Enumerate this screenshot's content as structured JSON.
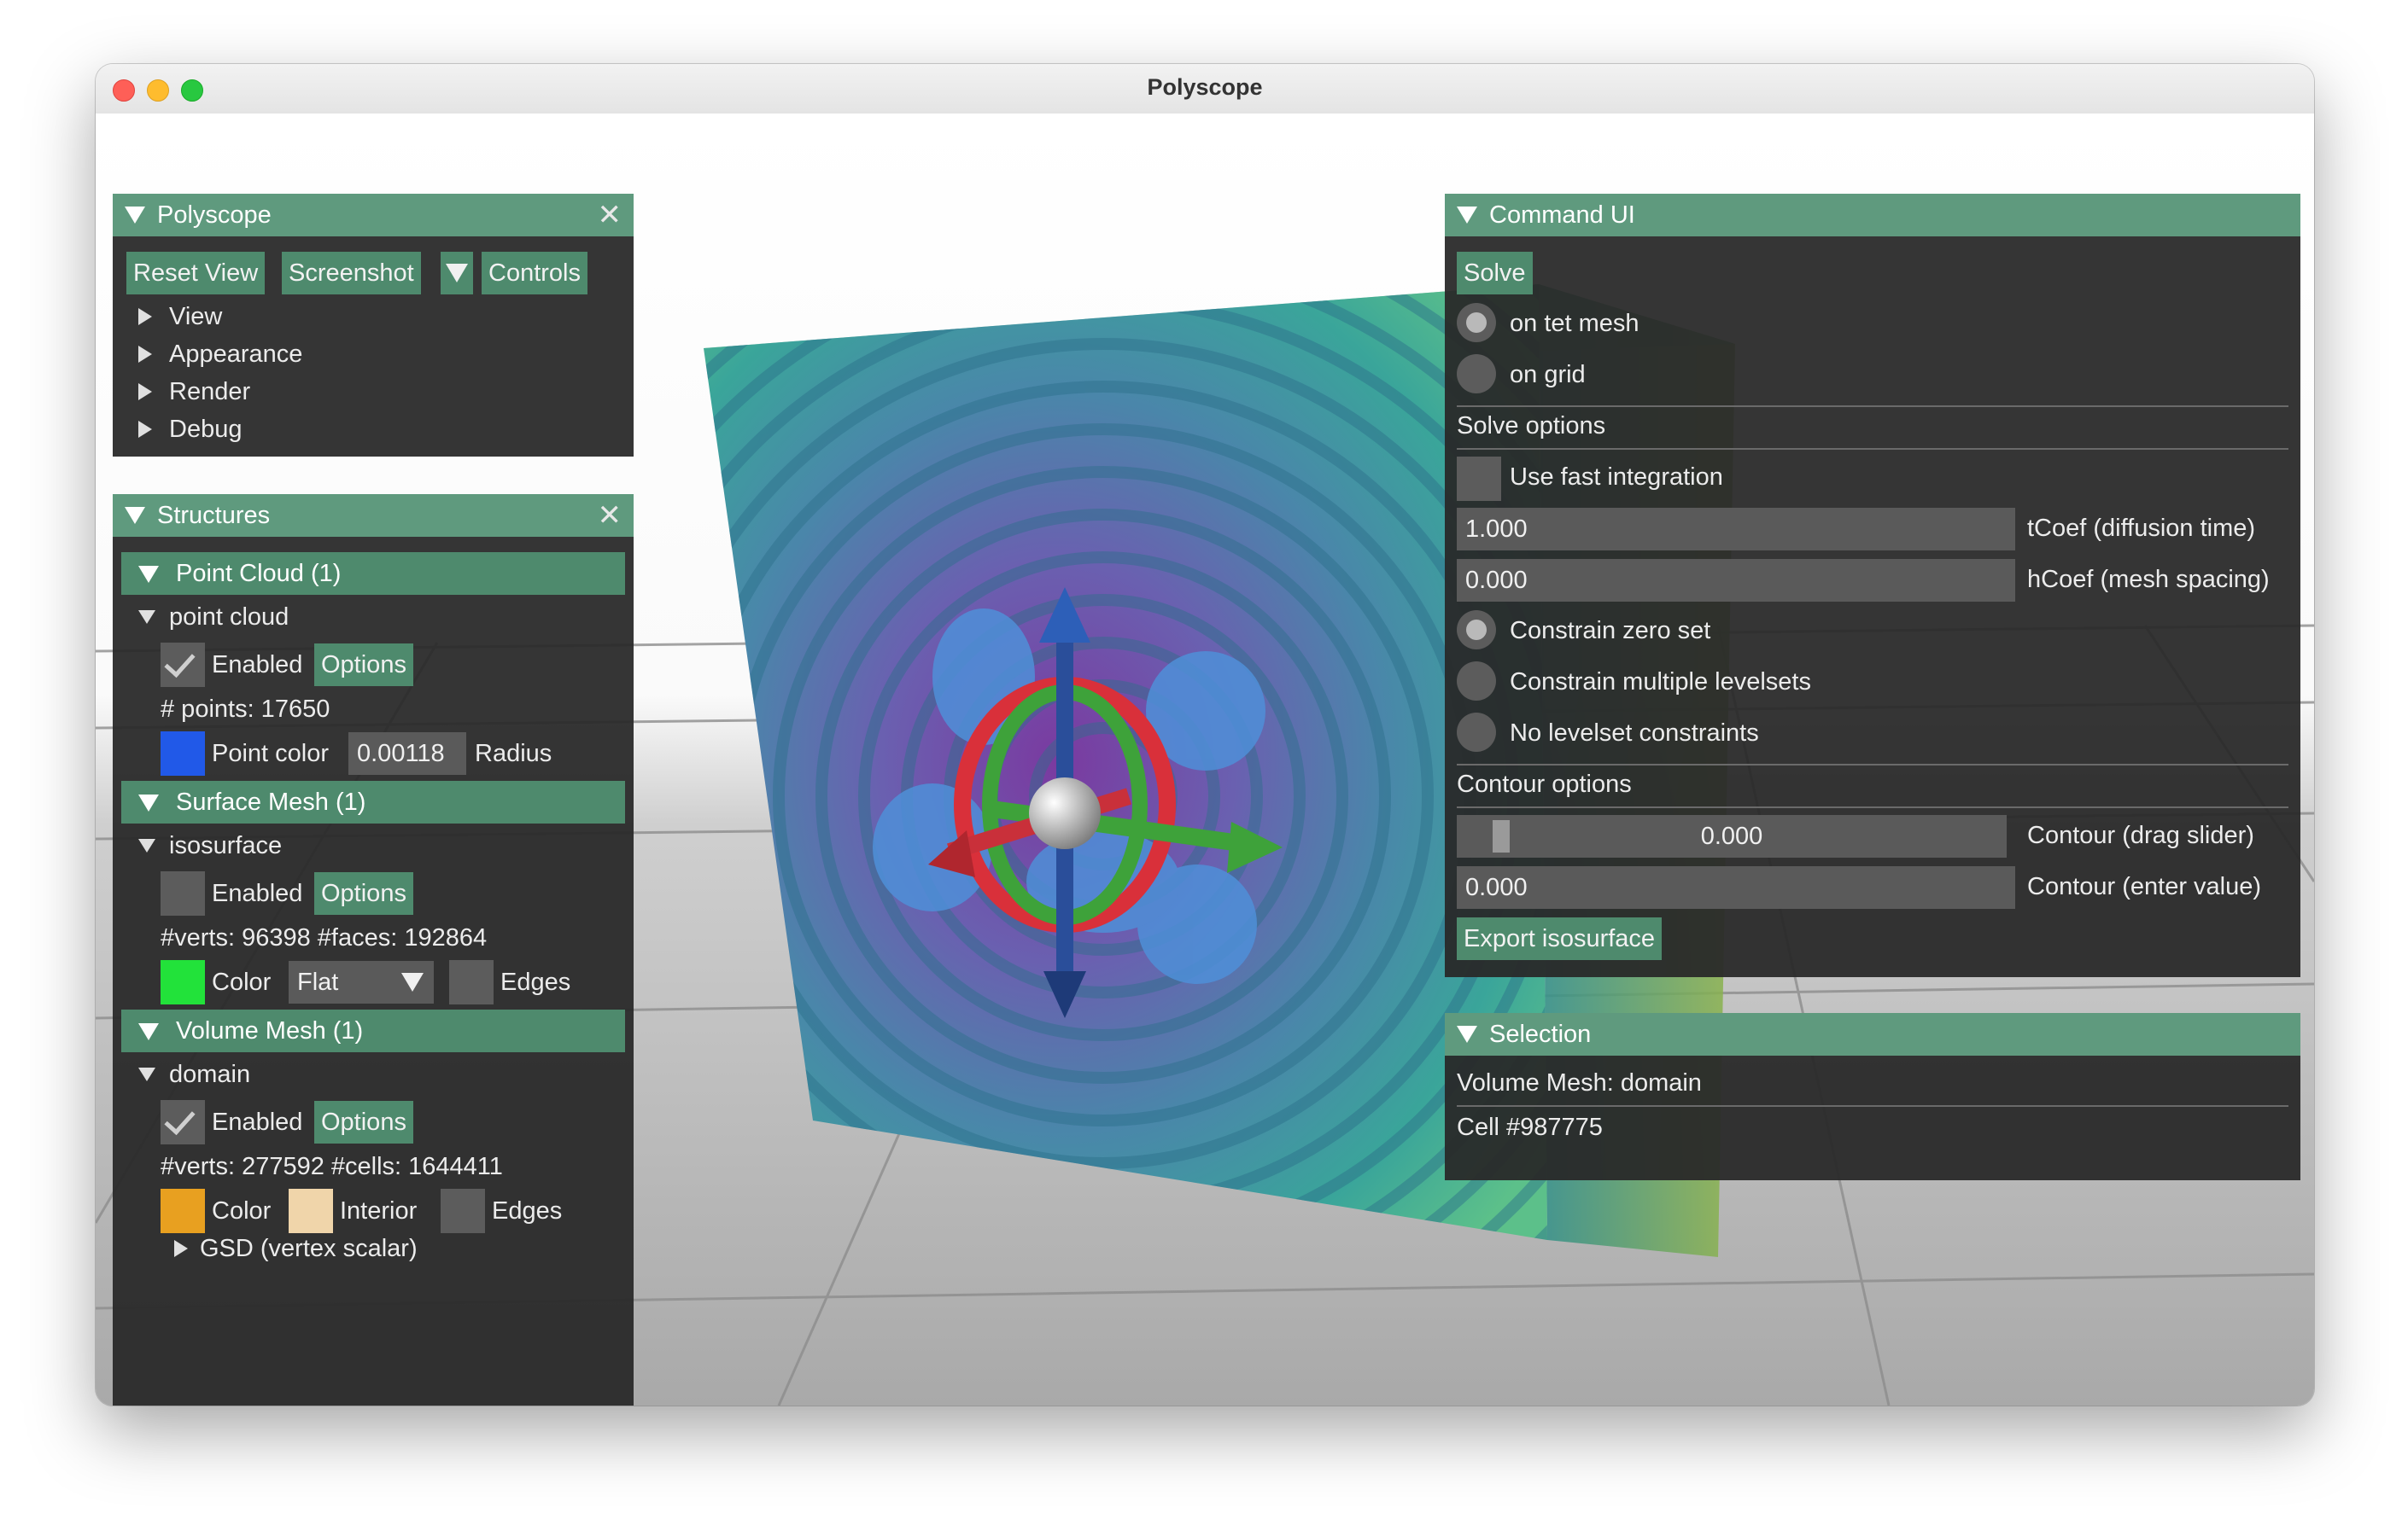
{
  "window": {
    "title": "Polyscope"
  },
  "polyscope_panel": {
    "title": "Polyscope",
    "buttons": {
      "reset_view": "Reset View",
      "screenshot": "Screenshot",
      "controls": "Controls"
    },
    "menu": [
      "View",
      "Appearance",
      "Render",
      "Debug"
    ]
  },
  "structures_panel": {
    "title": "Structures",
    "point_cloud": {
      "section": "Point Cloud (1)",
      "name": "point cloud",
      "enabled_label": "Enabled",
      "options_label": "Options",
      "info": "# points: 17650",
      "color_label": "Point color",
      "color": "#2159e8",
      "radius_value": "0.00118",
      "radius_label": "Radius"
    },
    "surface_mesh": {
      "section": "Surface Mesh (1)",
      "name": "isosurface",
      "enabled_label": "Enabled",
      "options_label": "Options",
      "info": "#verts: 96398  #faces: 192864",
      "color_label": "Color",
      "color": "#22e23a",
      "shading": "Flat",
      "edges_label": "Edges"
    },
    "volume_mesh": {
      "section": "Volume Mesh (1)",
      "name": "domain",
      "enabled_label": "Enabled",
      "options_label": "Options",
      "info": "#verts: 277592  #cells: 1644411",
      "color_label": "Color",
      "color": "#e8a020",
      "interior_label": "Interior",
      "interior_color": "#f0d5aa",
      "edges_label": "Edges",
      "quantity": "GSD (vertex scalar)"
    }
  },
  "command_panel": {
    "title": "Command UI",
    "solve_label": "Solve",
    "on_tet_mesh": "on tet mesh",
    "on_grid": "on grid",
    "solve_options": "Solve options",
    "fast_integration": "Use fast integration",
    "tcoef_value": "1.000",
    "tcoef_label": "tCoef (diffusion time)",
    "hcoef_value": "0.000",
    "hcoef_label": "hCoef (mesh spacing)",
    "constrain_zero": "Constrain zero set",
    "constrain_multiple": "Constrain multiple levelsets",
    "no_constraints": "No levelset constraints",
    "contour_options": "Contour options",
    "contour_slider_value": "0.000",
    "contour_slider_label": "Contour (drag slider)",
    "contour_enter_value": "0.000",
    "contour_enter_label": "Contour (enter value)",
    "export_label": "Export isosurface"
  },
  "selection_panel": {
    "title": "Selection",
    "structure": "Volume Mesh: domain",
    "cell": "Cell #987775"
  }
}
